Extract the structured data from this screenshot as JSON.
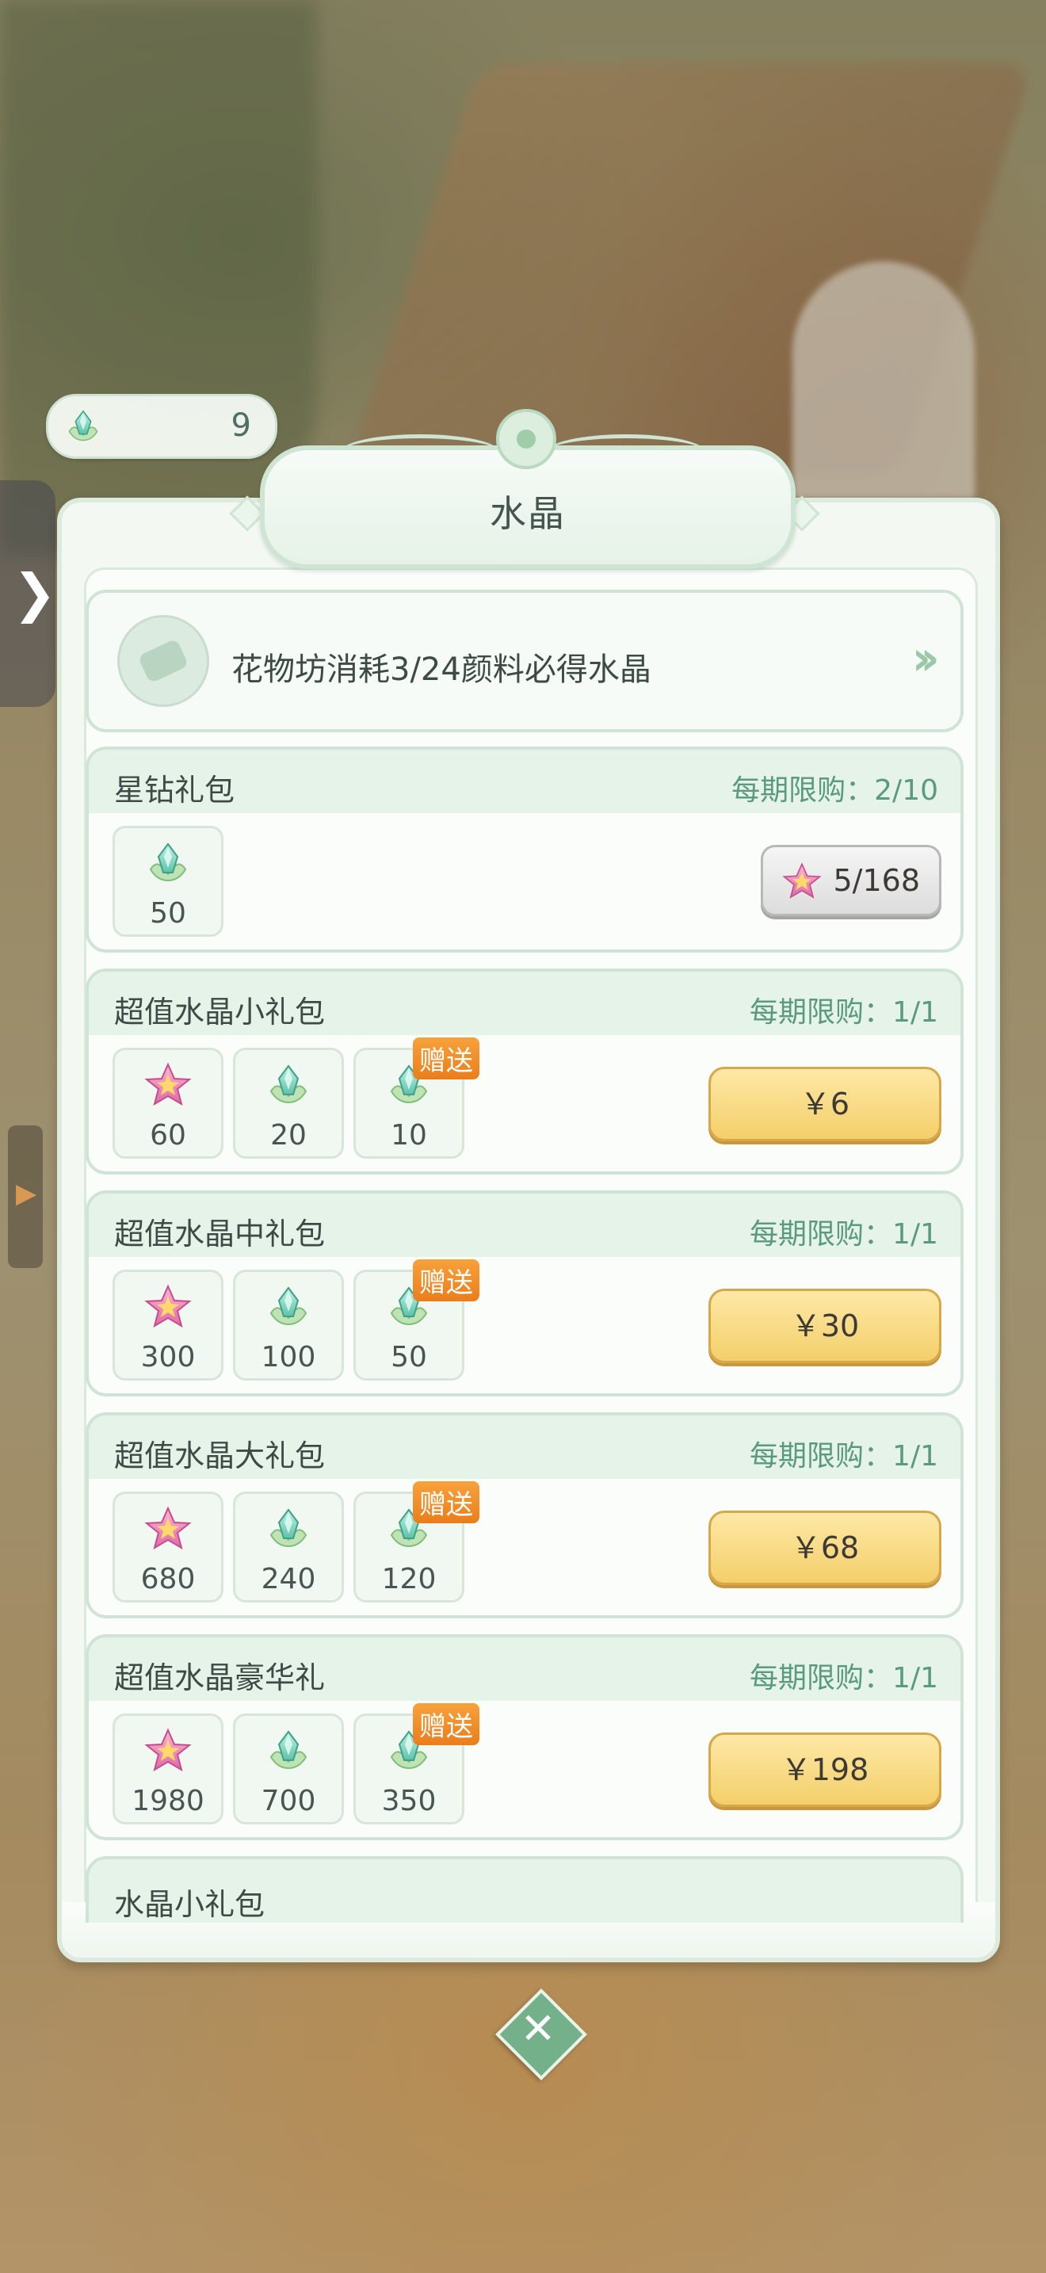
{
  "counter": {
    "value": "9",
    "icon": "crystal-icon"
  },
  "title": "水晶",
  "notice": {
    "text": "花物坊消耗3/24颜料必得水晶"
  },
  "packs": [
    {
      "name": "星钻礼包",
      "limit": "每期限购：2/10",
      "items": [
        {
          "icon": "crystal-icon",
          "count": "50"
        }
      ],
      "price": "5/168"
    },
    {
      "name": "超值水晶小礼包",
      "limit": "每期限购：1/1",
      "items": [
        {
          "icon": "star-icon",
          "count": "60"
        },
        {
          "icon": "crystal-icon",
          "count": "20"
        },
        {
          "icon": "crystal-icon",
          "count": "10",
          "bonus": "赠送"
        }
      ],
      "price": "￥6"
    },
    {
      "name": "超值水晶中礼包",
      "limit": "每期限购：1/1",
      "items": [
        {
          "icon": "star-icon",
          "count": "300"
        },
        {
          "icon": "crystal-icon",
          "count": "100"
        },
        {
          "icon": "crystal-icon",
          "count": "50",
          "bonus": "赠送"
        }
      ],
      "price": "￥30"
    },
    {
      "name": "超值水晶大礼包",
      "limit": "每期限购：1/1",
      "items": [
        {
          "icon": "star-icon",
          "count": "680"
        },
        {
          "icon": "crystal-icon",
          "count": "240"
        },
        {
          "icon": "crystal-icon",
          "count": "120",
          "bonus": "赠送"
        }
      ],
      "price": "￥68"
    },
    {
      "name": "超值水晶豪华礼",
      "limit": "每期限购：1/1",
      "items": [
        {
          "icon": "star-icon",
          "count": "1980"
        },
        {
          "icon": "crystal-icon",
          "count": "700"
        },
        {
          "icon": "crystal-icon",
          "count": "350",
          "bonus": "赠送"
        }
      ],
      "price": "￥198"
    }
  ],
  "partial_pack": {
    "name": "水晶小礼包"
  },
  "colors": {
    "accent": "#5a9a7e",
    "price_button": "#f4cf6a",
    "bonus": "#ea7d1c"
  }
}
